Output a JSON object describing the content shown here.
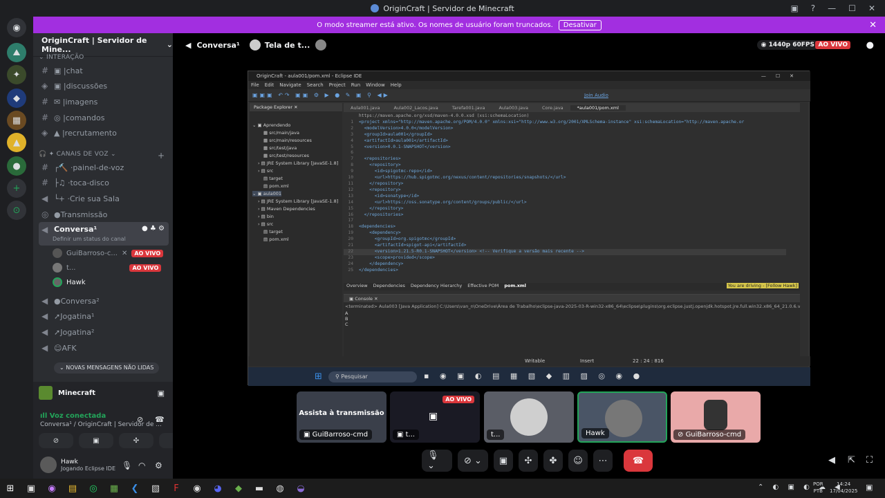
{
  "window": {
    "title": "OriginCraft | Servidor de Minecraft"
  },
  "streamer": {
    "message": "O modo streamer está ativo. Os nomes de usuário foram truncados.",
    "button": "Desativar"
  },
  "server": {
    "name": "OriginCraft | Servidor de Mine..."
  },
  "categories": {
    "interacao": "INTERAÇÃO",
    "voz": "CANAIS DE VOZ",
    "new_msgs": "NOVAS MENSAGENS NÃO LIDAS"
  },
  "text_channels": [
    "chat",
    "discussões",
    "imagens",
    "comandos",
    "recrutamento"
  ],
  "voice_channels": [
    "painel-de-voz",
    "toca-disco",
    "Crie sua Sala",
    "Transmissão"
  ],
  "current_voice": {
    "name": "Conversa¹",
    "status_hint": "Definir um status do canal"
  },
  "voice_users": [
    {
      "name": "GuiBarroso-c...",
      "badge": "AO VIVO"
    },
    {
      "name": "t...",
      "badge": "AO VIVO"
    },
    {
      "name": "Hawk",
      "badge": ""
    }
  ],
  "other_voice": [
    "Conversa²",
    "Jogatina¹",
    "Jogatina²",
    "AFK"
  ],
  "activity": {
    "game": "Minecraft"
  },
  "voice_status": {
    "title": "Voz conectada",
    "sub": "Conversa¹ / OriginCraft | Servidor de ..."
  },
  "user": {
    "name": "Hawk",
    "activity": "Jogando Eclipse IDE"
  },
  "topbar": {
    "channel": "Conversa¹",
    "screen": "Tela de t...",
    "quality": "1440p 60FPS",
    "live": "AO VIVO"
  },
  "eclipse": {
    "title": "OriginCraft - aula001/pom.xml - Eclipse IDE",
    "menu": [
      "File",
      "Edit",
      "Navigate",
      "Search",
      "Project",
      "Run",
      "Window",
      "Help"
    ],
    "join_audio": "Join Audio",
    "package_explorer": "Package Explorer",
    "tree": [
      "Aprendendo",
      "src/main/java",
      "src/main/resources",
      "src/test/java",
      "src/test/resources",
      "JRE System Library [JavaSE-1.8]",
      "src",
      "target",
      "pom.xml",
      "aula001",
      "JRE System Library [JavaSE-1.8]",
      "Maven Dependencies",
      "bin",
      "src",
      "target",
      "pom.xml"
    ],
    "tabs": [
      "Aula001.java",
      "Aula002_Lacos.java",
      "Tarefa001.java",
      "Aula003.java",
      "Core.java",
      "*aula001/pom.xml"
    ],
    "code": [
      "https://maven.apache.org/xsd/maven-4.0.0.xsd (xsi:schemaLocation)",
      "<project xmlns=\"http://maven.apache.org/POM/4.0.0\" xmlns:xsi=\"http://www.w3.org/2001/XMLSchema-instance\" xsi:schemaLocation=\"http://maven.apache.or",
      "  <modelVersion>4.0.0</modelVersion>",
      "  <groupId>aula001</groupId>",
      "  <artifactId>aula001</artifactId>",
      "  <version>0.0.1-SNAPSHOT</version>",
      "",
      "  <repositories>",
      "    <repository>",
      "      <id>spigotmc-repo</id>",
      "      <url>https://hub.spigotmc.org/nexus/content/repositories/snapshots/</url>",
      "    </repository>",
      "    <repository>",
      "      <id>sonatype</id>",
      "      <url>https://oss.sonatype.org/content/groups/public/</url>",
      "    </repository>",
      "  </repositories>",
      "",
      "<dependencies>",
      "    <dependency>",
      "      <groupId>org.spigotmc</groupId>",
      "      <artifactId>spigot-api</artifactId>",
      "      <version>1.21.5-R0.1-SNAPSHOT</version> <!-- Verifique a versão mais recente -->",
      "      <scope>provided</scope>",
      "    </dependency>",
      "</dependencies>"
    ],
    "pom_tabs": [
      "Overview",
      "Dependencies",
      "Dependency Hierarchy",
      "Effective POM",
      "pom.xml"
    ],
    "driving": "You are driving - [Follow Hawk]",
    "console_title": "Console",
    "console_terminated": "<terminated> Aula003 [Java Application] C:\\Users\\van_n\\OneDrive\\Área de Trabalho\\eclipse-java-2025-03-R-win32-x86_64\\eclipse\\plugins\\org.eclipse.justj.openjdk.hotspot.jre.full.win32.x86_64_21.0.6.v20250130",
    "console_out": [
      "A",
      "B",
      "C"
    ],
    "status": [
      "Writable",
      "Insert",
      "22 : 24 : 816"
    ],
    "search": "Pesquisar"
  },
  "tiles": [
    {
      "label": "GuiBarroso-cmd",
      "overlay": "Assista à transmissão"
    },
    {
      "label": "t...",
      "badge": "AO VIVO"
    },
    {
      "label": "t..."
    },
    {
      "label": "Hawk"
    },
    {
      "label": "GuiBarroso-cmd"
    }
  ],
  "taskbar": {
    "lang1": "POR",
    "lang2": "PTB",
    "time": "14:24",
    "date": "17/04/2025"
  }
}
